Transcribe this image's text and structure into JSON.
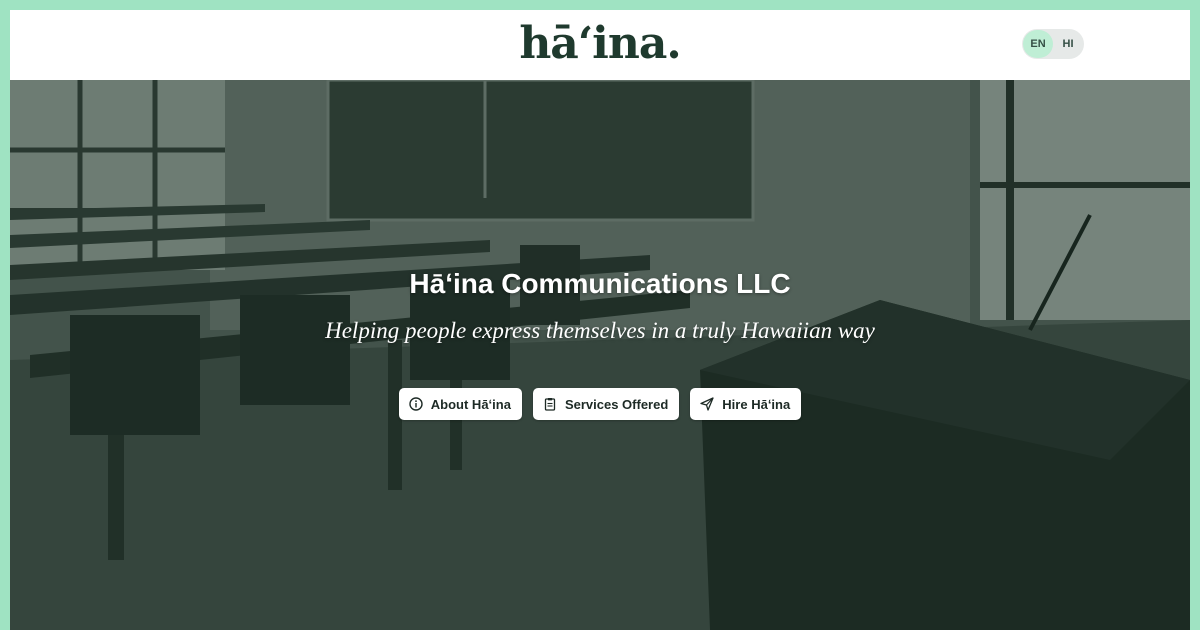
{
  "header": {
    "logo_text": "hāʻina."
  },
  "language_toggle": {
    "options": [
      {
        "label": "EN",
        "active": true
      },
      {
        "label": "HI",
        "active": false
      }
    ]
  },
  "hero": {
    "title": "Hāʻina Communications LLC",
    "subtitle": "Helping people express themselves in a truly Hawaiian way",
    "buttons": [
      {
        "label": "About Hāʻina",
        "icon": "info-circle-icon"
      },
      {
        "label": "Services Offered",
        "icon": "clipboard-icon"
      },
      {
        "label": "Hire Hāʻina",
        "icon": "paper-plane-icon"
      }
    ]
  },
  "colors": {
    "frame_border": "#9fe3c2",
    "logo": "#1f3a2e",
    "hero_overlay": "#142d20",
    "toggle_active": "#bfeed5"
  }
}
